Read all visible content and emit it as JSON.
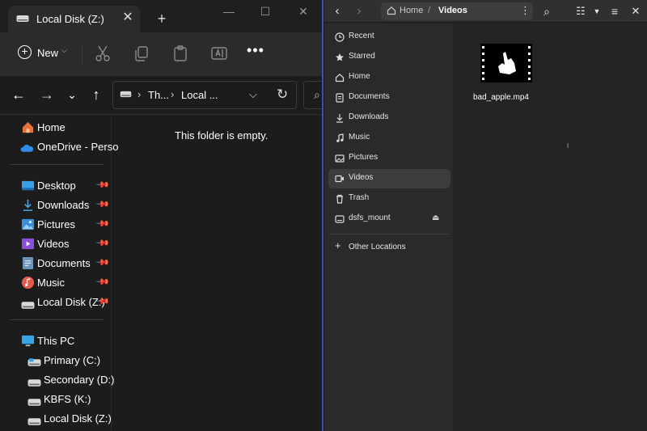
{
  "explorer": {
    "tab": {
      "title": "Local Disk (Z:)",
      "close": "✕"
    },
    "new_tab": "+",
    "window_controls": {
      "minimize": "—",
      "maximize": "☐",
      "close": "✕"
    },
    "toolbar": {
      "new_label": "New",
      "more": "•••"
    },
    "address": {
      "crumb1": "Th...",
      "crumb2": "Local ...",
      "sep": "›"
    },
    "sidebar": {
      "quick": [
        {
          "label": "Home",
          "icon": "home-icon"
        },
        {
          "label": "OneDrive - Perso",
          "icon": "onedrive-icon"
        }
      ],
      "pinned": [
        {
          "label": "Desktop",
          "icon": "desktop-icon"
        },
        {
          "label": "Downloads",
          "icon": "download-icon"
        },
        {
          "label": "Pictures",
          "icon": "pictures-icon"
        },
        {
          "label": "Videos",
          "icon": "videos-icon"
        },
        {
          "label": "Documents",
          "icon": "documents-icon"
        },
        {
          "label": "Music",
          "icon": "music-icon"
        },
        {
          "label": "Local Disk (Z:)",
          "icon": "drive-icon"
        }
      ],
      "this_pc": {
        "label": "This PC",
        "icon": "pc-icon"
      },
      "drives": [
        {
          "label": "Primary (C:)",
          "icon": "drive-icon"
        },
        {
          "label": "Secondary (D:)",
          "icon": "drive-icon"
        },
        {
          "label": "KBFS (K:)",
          "icon": "drive-icon"
        },
        {
          "label": "Local Disk (Z:)",
          "icon": "drive-icon"
        }
      ]
    },
    "empty_message": "This folder is empty."
  },
  "files": {
    "path": {
      "home": "Home",
      "current": "Videos"
    },
    "sidebar": [
      {
        "label": "Recent",
        "icon": "clock-icon"
      },
      {
        "label": "Starred",
        "icon": "star-icon"
      },
      {
        "label": "Home",
        "icon": "home-icon"
      },
      {
        "label": "Documents",
        "icon": "document-icon"
      },
      {
        "label": "Downloads",
        "icon": "download-icon"
      },
      {
        "label": "Music",
        "icon": "music-icon"
      },
      {
        "label": "Pictures",
        "icon": "picture-icon"
      },
      {
        "label": "Videos",
        "icon": "video-icon",
        "active": true
      },
      {
        "label": "Trash",
        "icon": "trash-icon"
      },
      {
        "label": "dsfs_mount",
        "icon": "drive-icon"
      }
    ],
    "other_locations": "Other Locations",
    "file": {
      "name": "bad_apple.mp4"
    }
  },
  "colors": {
    "accent_blue": "#3355aa",
    "explorer_bg": "#1c1c1c",
    "files_bg": "#242424"
  }
}
